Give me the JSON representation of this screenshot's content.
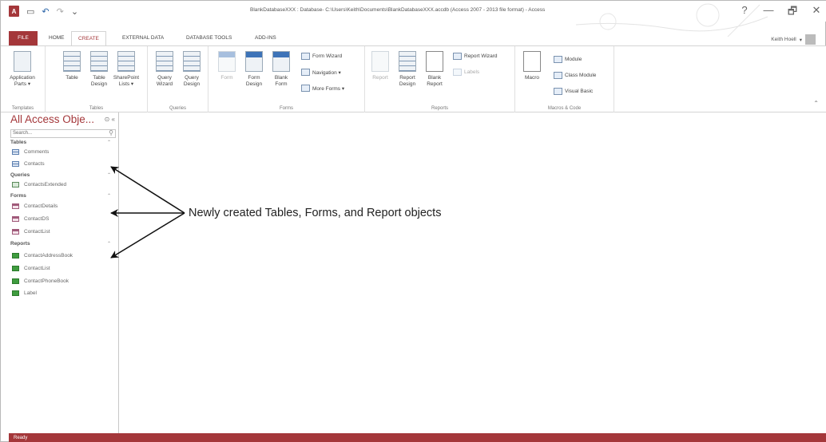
{
  "window": {
    "title": "BlankDatabaseXXX : Database- C:\\Users\\Keith\\Documents\\BlankDatabaseXXX.accdb (Access 2007 - 2013 file format) - Access",
    "controls": [
      "?",
      "—",
      "🗗",
      "✕"
    ]
  },
  "qat": {
    "app_icon": "A",
    "save": "▭",
    "undo": "↶",
    "redo": "↷",
    "customize": "⌄"
  },
  "tabs": {
    "file": "FILE",
    "home": "HOME",
    "create": "CREATE",
    "external_data": "EXTERNAL DATA",
    "database_tools": "DATABASE TOOLS",
    "add_ins": "ADD-INS"
  },
  "user": {
    "name": "Keith Hoell",
    "menu": "▾"
  },
  "ribbon": {
    "templates": {
      "label": "Templates",
      "application_parts": "Application\nParts ▾"
    },
    "tables": {
      "label": "Tables",
      "table": "Table",
      "table_design": "Table\nDesign",
      "sharepoint_lists": "SharePoint\nLists ▾"
    },
    "queries": {
      "label": "Queries",
      "query_wizard": "Query\nWizard",
      "query_design": "Query\nDesign"
    },
    "forms": {
      "label": "Forms",
      "form": "Form",
      "form_design": "Form\nDesign",
      "blank_form": "Blank\nForm",
      "form_wizard": "Form Wizard",
      "navigation": "Navigation ▾",
      "more_forms": "More Forms ▾"
    },
    "reports": {
      "label": "Reports",
      "report": "Report",
      "report_design": "Report\nDesign",
      "blank_report": "Blank\nReport",
      "report_wizard": "Report Wizard",
      "labels": "Labels"
    },
    "macros": {
      "label": "Macros & Code",
      "macro": "Macro",
      "module": "Module",
      "class_module": "Class Module",
      "visual_basic": "Visual Basic"
    },
    "collapse": "⌃"
  },
  "nav": {
    "title": "All Access Obje...",
    "controls": "⊙ «",
    "search_placeholder": "Search...",
    "search_icon": "⚲",
    "sections": [
      {
        "label": "Tables",
        "chevron": "⌃",
        "items": [
          "Comments",
          "Contacts"
        ]
      },
      {
        "label": "Queries",
        "chevron": "⌃",
        "items": [
          "ContactsExtended"
        ]
      },
      {
        "label": "Forms",
        "chevron": "⌃",
        "items": [
          "ContactDetails",
          "ContactDS",
          "ContactList"
        ]
      },
      {
        "label": "Reports",
        "chevron": "⌃",
        "items": [
          "ContactAddressBook",
          "ContactList",
          "ContactPhoneBook",
          "Label"
        ]
      }
    ]
  },
  "annotation": {
    "text": "Newly created Tables, Forms, and Report objects"
  },
  "status": {
    "text": "Ready"
  }
}
